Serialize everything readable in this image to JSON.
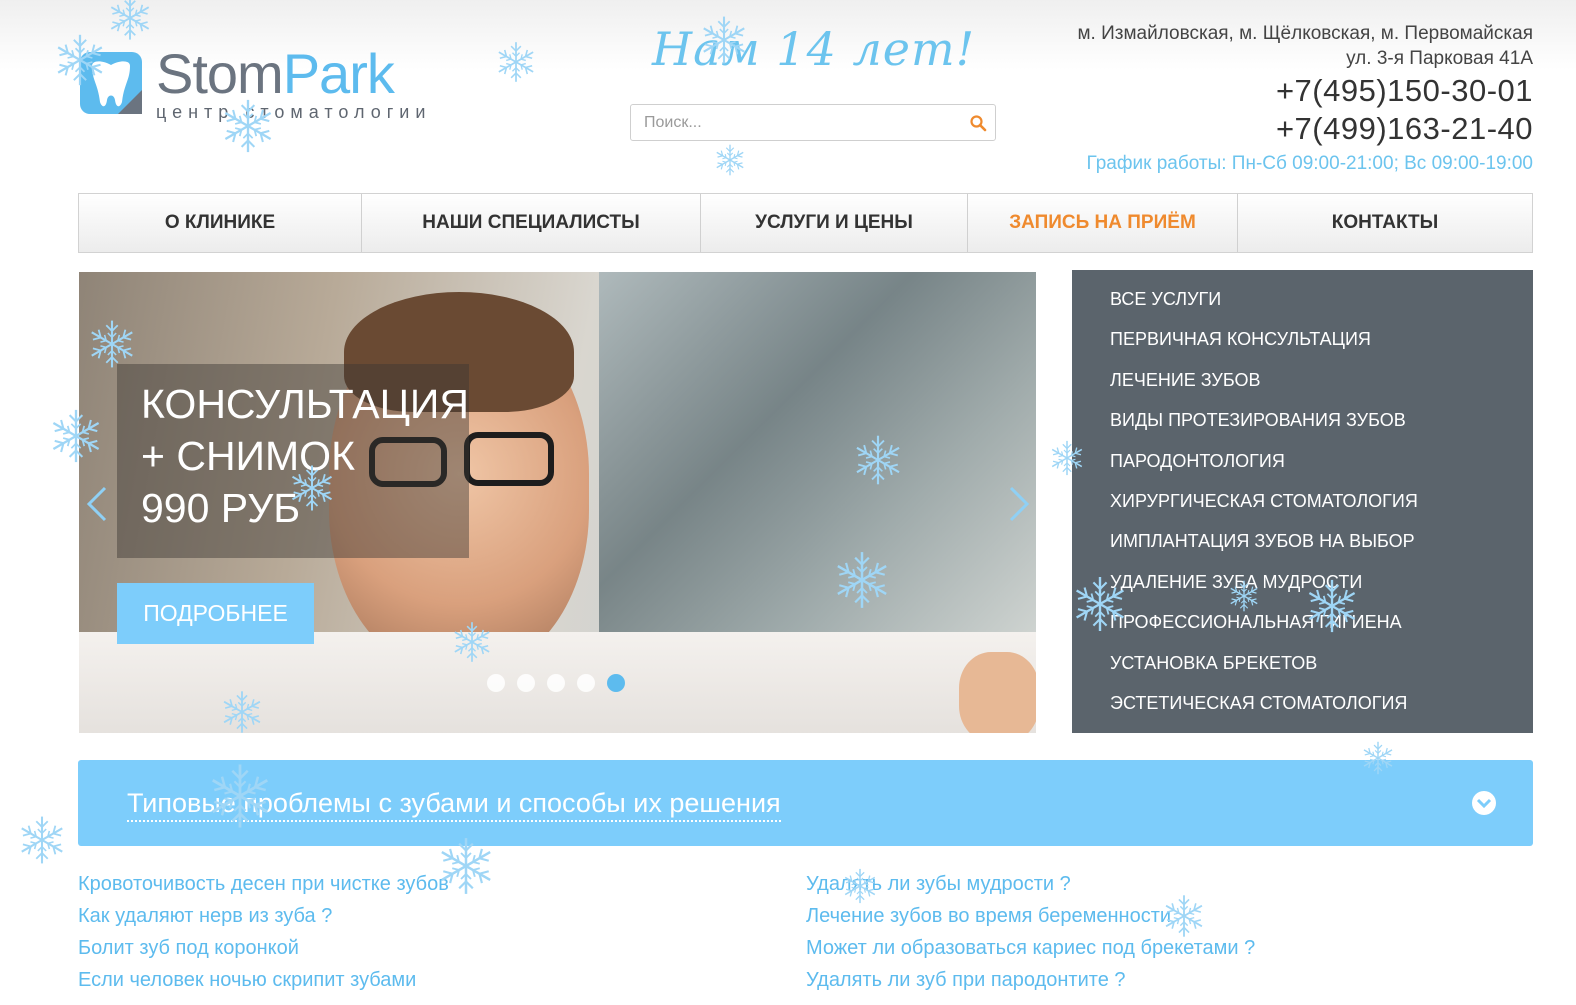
{
  "header": {
    "logo": {
      "name_part1": "Stom",
      "name_part2": "Park",
      "subtitle": "центр стоматологии"
    },
    "anniversary": "Нам 14 лет!",
    "search": {
      "placeholder": "Поиск..."
    },
    "contacts": {
      "metro": "м. Измайловская, м. Щёлковская, м. Первомайская",
      "address": "ул. 3-я Парковая 41А",
      "phone1": "+7(495)150-30-01",
      "phone2": "+7(499)163-21-40",
      "hours": "График работы: Пн-Сб 09:00-21:00; Вс 09:00-19:00"
    }
  },
  "nav": {
    "items": [
      {
        "label": "О КЛИНИКЕ"
      },
      {
        "label": "НАШИ СПЕЦИАЛИСТЫ"
      },
      {
        "label": "УСЛУГИ И ЦЕНЫ"
      },
      {
        "label": "ЗАПИСЬ НА ПРИЁМ"
      },
      {
        "label": "КОНТАКТЫ"
      }
    ]
  },
  "slider": {
    "promo_lines": [
      "КОНСУЛЬТАЦИЯ",
      "+ СНИМОК",
      "990 РУБ"
    ],
    "button_label": "ПОДРОБНЕЕ",
    "slide_count": 5,
    "active_slide": 5
  },
  "services": {
    "items": [
      "ВСЕ УСЛУГИ",
      "ПЕРВИЧНАЯ КОНСУЛЬТАЦИЯ",
      "ЛЕЧЕНИЕ ЗУБОВ",
      "ВИДЫ ПРОТЕЗИРОВАНИЯ ЗУБОВ",
      "ПАРОДОНТОЛОГИЯ",
      "ХИРУРГИЧЕСКАЯ СТОМАТОЛОГИЯ",
      "ИМПЛАНТАЦИЯ ЗУБОВ НА ВЫБОР",
      "УДАЛЕНИЕ ЗУБА МУДРОСТИ",
      "ПРОФЕССИОНАЛЬНАЯ ГИГИЕНА",
      "УСТАНОВКА БРЕКЕТОВ",
      "ЭСТЕТИЧЕСКАЯ СТОМАТОЛОГИЯ"
    ]
  },
  "faq": {
    "title": "Типовые проблемы с зубами и способы их решения",
    "left": [
      "Кровоточивость десен при чистке зубов",
      "Как удаляют нерв из зуба ?",
      "Болит зуб под коронкой",
      "Если человек ночью скрипит зубами"
    ],
    "right": [
      "Удалять ли зубы мудрости ?",
      "Лечение зубов во время беременности",
      "Может ли образоваться кариес под брекетами ?",
      "Удалять ли зуб при пародонтите ?"
    ]
  },
  "colors": {
    "brand_blue": "#5dbbee",
    "accent_orange": "#ef8a2e",
    "panel_gray": "#5b646c",
    "bar_blue": "#7dcdfb"
  },
  "icons": {
    "search": "search-icon",
    "snowflake": "snowflake-icon",
    "chevron_down": "chevron-down-icon",
    "arrow_left": "arrow-left-icon",
    "arrow_right": "arrow-right-icon"
  }
}
